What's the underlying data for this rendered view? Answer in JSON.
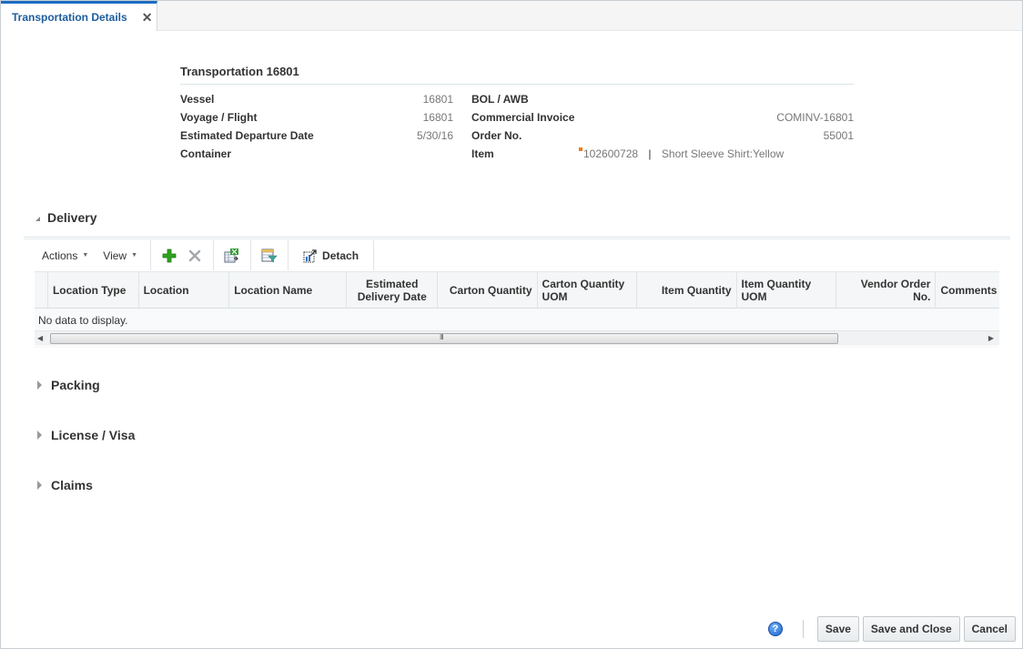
{
  "tab": {
    "label": "Transportation Details",
    "close_glyph": "✕"
  },
  "header": {
    "title": "Transportation 16801",
    "left_fields": [
      {
        "label": "Vessel",
        "value": "16801"
      },
      {
        "label": "Voyage / Flight",
        "value": "16801"
      },
      {
        "label": "Estimated Departure Date",
        "value": "5/30/16"
      },
      {
        "label": "Container",
        "value": ""
      }
    ],
    "right_fields": [
      {
        "label": "BOL / AWB",
        "value": ""
      },
      {
        "label": "Commercial Invoice",
        "value": "COMINV-16801"
      },
      {
        "label": "Order No.",
        "value": "55001"
      },
      {
        "label": "Item",
        "value": "102600728",
        "separator": "|",
        "description": "Short Sleeve Shirt:Yellow"
      }
    ]
  },
  "sections": {
    "delivery": {
      "label": "Delivery",
      "expanded": true
    },
    "packing": {
      "label": "Packing",
      "expanded": false
    },
    "license": {
      "label": "License / Visa",
      "expanded": false
    },
    "claims": {
      "label": "Claims",
      "expanded": false
    }
  },
  "toolbar": {
    "actions_label": "Actions",
    "view_label": "View",
    "icons": [
      "add-icon",
      "delete-icon",
      "export-excel-icon",
      "query-filter-icon",
      "detach-icon"
    ],
    "detach_label": "Detach"
  },
  "table": {
    "columns": [
      "Location Type",
      "Location",
      "Location Name",
      "Estimated Delivery Date",
      "Carton Quantity",
      "Carton Quantity UOM",
      "Item Quantity",
      "Item Quantity UOM",
      "Vendor Order No.",
      "Comments"
    ],
    "empty_message": "No data to display.",
    "scroll_grip": "III"
  },
  "footer": {
    "help_glyph": "?",
    "save_label": "Save",
    "save_close_label": "Save and Close",
    "cancel_label": "Cancel"
  },
  "colors": {
    "tab_accent": "#1b6dc1",
    "item_marker": "#ee7c18",
    "add_green": "#2fa31f"
  }
}
